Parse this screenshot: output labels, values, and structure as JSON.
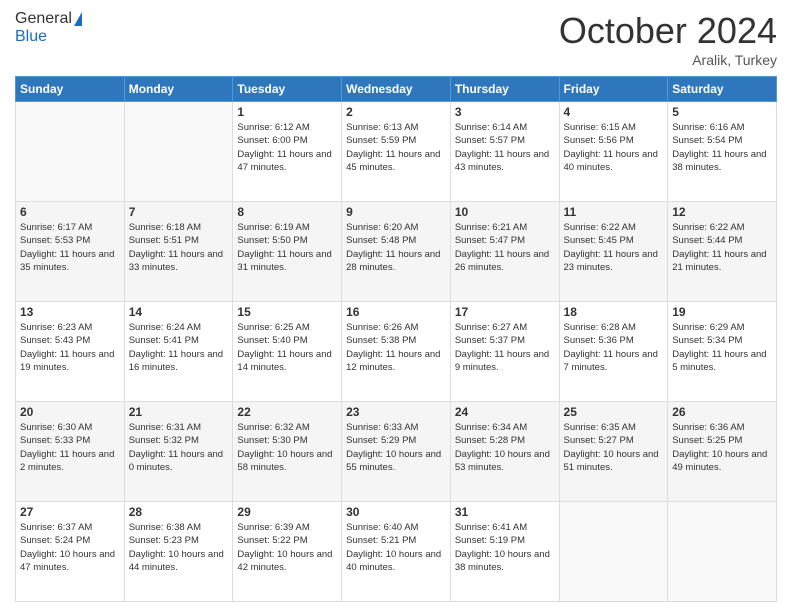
{
  "header": {
    "logo_general": "General",
    "logo_blue": "Blue",
    "title": "October 2024",
    "location": "Aralik, Turkey"
  },
  "columns": [
    "Sunday",
    "Monday",
    "Tuesday",
    "Wednesday",
    "Thursday",
    "Friday",
    "Saturday"
  ],
  "weeks": [
    [
      {
        "day": "",
        "info": ""
      },
      {
        "day": "",
        "info": ""
      },
      {
        "day": "1",
        "sunrise": "6:12 AM",
        "sunset": "6:00 PM",
        "daylight": "11 hours and 47 minutes."
      },
      {
        "day": "2",
        "sunrise": "6:13 AM",
        "sunset": "5:59 PM",
        "daylight": "11 hours and 45 minutes."
      },
      {
        "day": "3",
        "sunrise": "6:14 AM",
        "sunset": "5:57 PM",
        "daylight": "11 hours and 43 minutes."
      },
      {
        "day": "4",
        "sunrise": "6:15 AM",
        "sunset": "5:56 PM",
        "daylight": "11 hours and 40 minutes."
      },
      {
        "day": "5",
        "sunrise": "6:16 AM",
        "sunset": "5:54 PM",
        "daylight": "11 hours and 38 minutes."
      }
    ],
    [
      {
        "day": "6",
        "sunrise": "6:17 AM",
        "sunset": "5:53 PM",
        "daylight": "11 hours and 35 minutes."
      },
      {
        "day": "7",
        "sunrise": "6:18 AM",
        "sunset": "5:51 PM",
        "daylight": "11 hours and 33 minutes."
      },
      {
        "day": "8",
        "sunrise": "6:19 AM",
        "sunset": "5:50 PM",
        "daylight": "11 hours and 31 minutes."
      },
      {
        "day": "9",
        "sunrise": "6:20 AM",
        "sunset": "5:48 PM",
        "daylight": "11 hours and 28 minutes."
      },
      {
        "day": "10",
        "sunrise": "6:21 AM",
        "sunset": "5:47 PM",
        "daylight": "11 hours and 26 minutes."
      },
      {
        "day": "11",
        "sunrise": "6:22 AM",
        "sunset": "5:45 PM",
        "daylight": "11 hours and 23 minutes."
      },
      {
        "day": "12",
        "sunrise": "6:22 AM",
        "sunset": "5:44 PM",
        "daylight": "11 hours and 21 minutes."
      }
    ],
    [
      {
        "day": "13",
        "sunrise": "6:23 AM",
        "sunset": "5:43 PM",
        "daylight": "11 hours and 19 minutes."
      },
      {
        "day": "14",
        "sunrise": "6:24 AM",
        "sunset": "5:41 PM",
        "daylight": "11 hours and 16 minutes."
      },
      {
        "day": "15",
        "sunrise": "6:25 AM",
        "sunset": "5:40 PM",
        "daylight": "11 hours and 14 minutes."
      },
      {
        "day": "16",
        "sunrise": "6:26 AM",
        "sunset": "5:38 PM",
        "daylight": "11 hours and 12 minutes."
      },
      {
        "day": "17",
        "sunrise": "6:27 AM",
        "sunset": "5:37 PM",
        "daylight": "11 hours and 9 minutes."
      },
      {
        "day": "18",
        "sunrise": "6:28 AM",
        "sunset": "5:36 PM",
        "daylight": "11 hours and 7 minutes."
      },
      {
        "day": "19",
        "sunrise": "6:29 AM",
        "sunset": "5:34 PM",
        "daylight": "11 hours and 5 minutes."
      }
    ],
    [
      {
        "day": "20",
        "sunrise": "6:30 AM",
        "sunset": "5:33 PM",
        "daylight": "11 hours and 2 minutes."
      },
      {
        "day": "21",
        "sunrise": "6:31 AM",
        "sunset": "5:32 PM",
        "daylight": "11 hours and 0 minutes."
      },
      {
        "day": "22",
        "sunrise": "6:32 AM",
        "sunset": "5:30 PM",
        "daylight": "10 hours and 58 minutes."
      },
      {
        "day": "23",
        "sunrise": "6:33 AM",
        "sunset": "5:29 PM",
        "daylight": "10 hours and 55 minutes."
      },
      {
        "day": "24",
        "sunrise": "6:34 AM",
        "sunset": "5:28 PM",
        "daylight": "10 hours and 53 minutes."
      },
      {
        "day": "25",
        "sunrise": "6:35 AM",
        "sunset": "5:27 PM",
        "daylight": "10 hours and 51 minutes."
      },
      {
        "day": "26",
        "sunrise": "6:36 AM",
        "sunset": "5:25 PM",
        "daylight": "10 hours and 49 minutes."
      }
    ],
    [
      {
        "day": "27",
        "sunrise": "6:37 AM",
        "sunset": "5:24 PM",
        "daylight": "10 hours and 47 minutes."
      },
      {
        "day": "28",
        "sunrise": "6:38 AM",
        "sunset": "5:23 PM",
        "daylight": "10 hours and 44 minutes."
      },
      {
        "day": "29",
        "sunrise": "6:39 AM",
        "sunset": "5:22 PM",
        "daylight": "10 hours and 42 minutes."
      },
      {
        "day": "30",
        "sunrise": "6:40 AM",
        "sunset": "5:21 PM",
        "daylight": "10 hours and 40 minutes."
      },
      {
        "day": "31",
        "sunrise": "6:41 AM",
        "sunset": "5:19 PM",
        "daylight": "10 hours and 38 minutes."
      },
      {
        "day": "",
        "info": ""
      },
      {
        "day": "",
        "info": ""
      }
    ]
  ]
}
